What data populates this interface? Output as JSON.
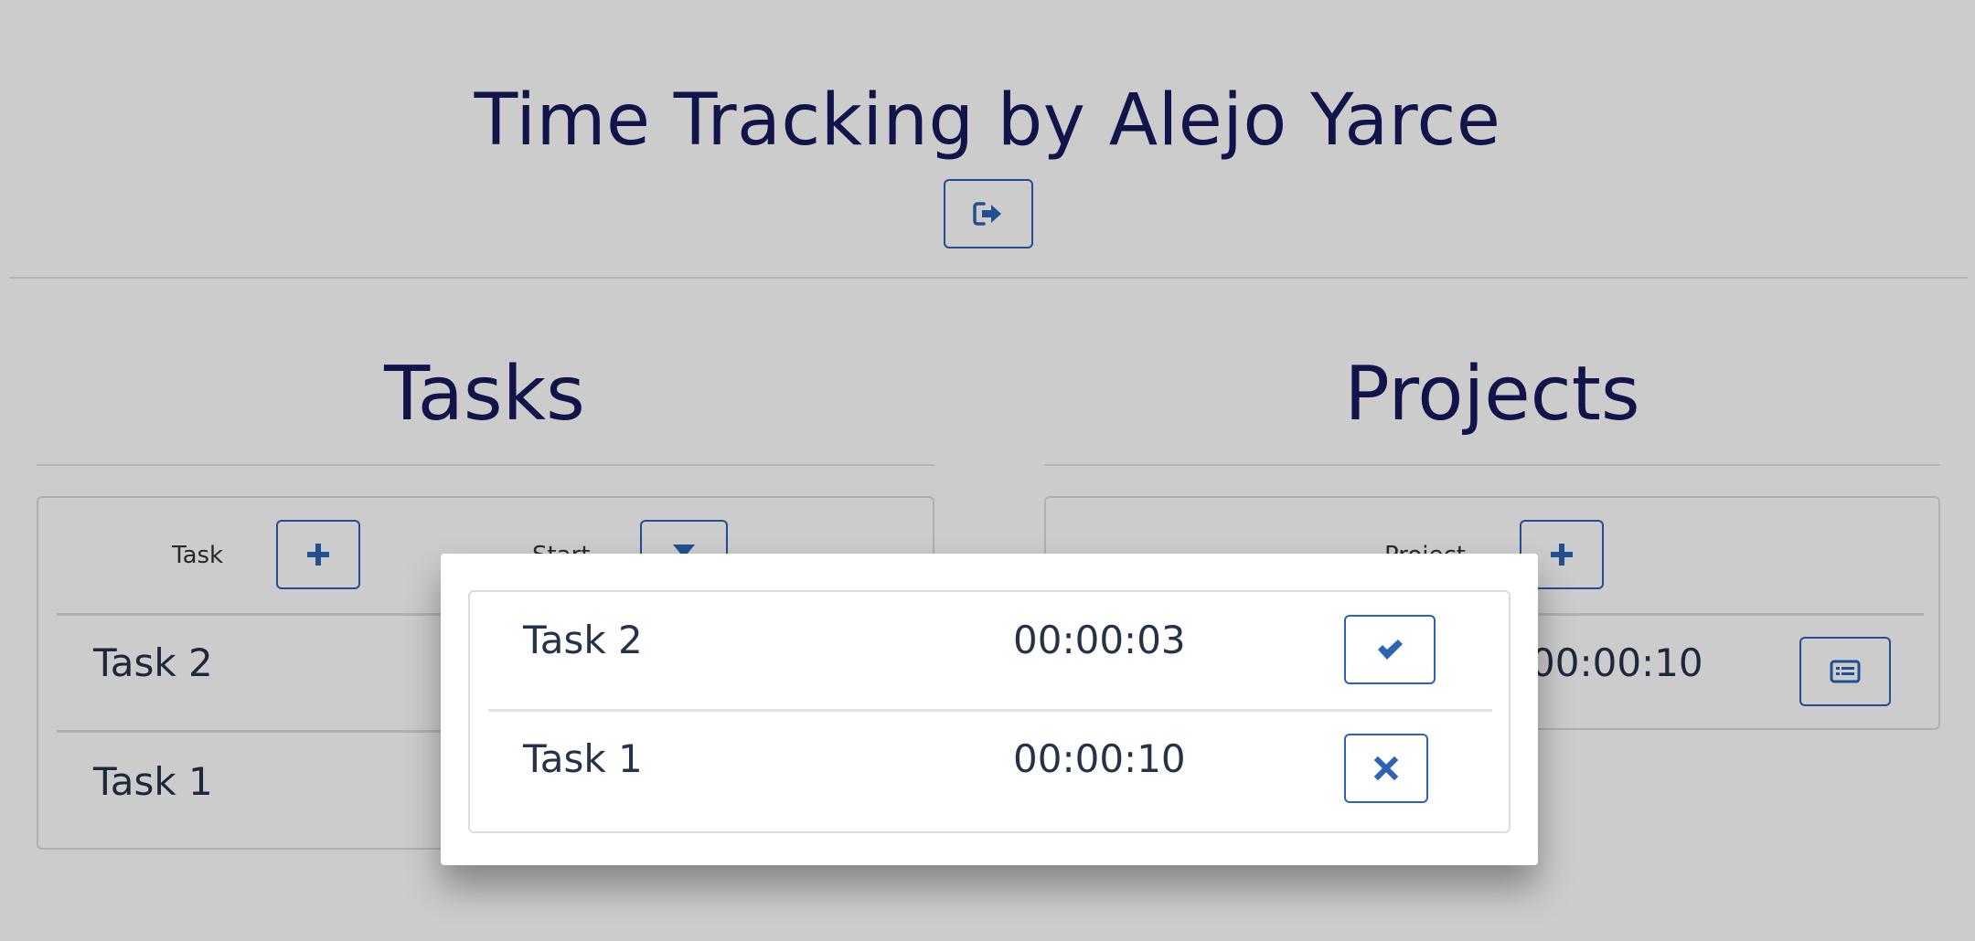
{
  "header": {
    "title": "Time Tracking by Alejo Yarce"
  },
  "tasks": {
    "title": "Tasks",
    "columns": {
      "task": "Task",
      "start": "Start"
    },
    "rows": [
      {
        "name": "Task 2"
      },
      {
        "name": "Task 1"
      }
    ]
  },
  "projects": {
    "title": "Projects",
    "columns": {
      "project": "Project"
    },
    "rows": [
      {
        "time": "00:00:10"
      }
    ]
  },
  "modal": {
    "rows": [
      {
        "name": "Task 2",
        "time": "00:00:03",
        "action": "check-icon"
      },
      {
        "name": "Task 1",
        "time": "00:00:10",
        "action": "times-icon"
      }
    ]
  },
  "colors": {
    "title": "#151a5e",
    "accent": "#2b63b6",
    "text": "#26324a",
    "divider": "#e3e3e3"
  }
}
